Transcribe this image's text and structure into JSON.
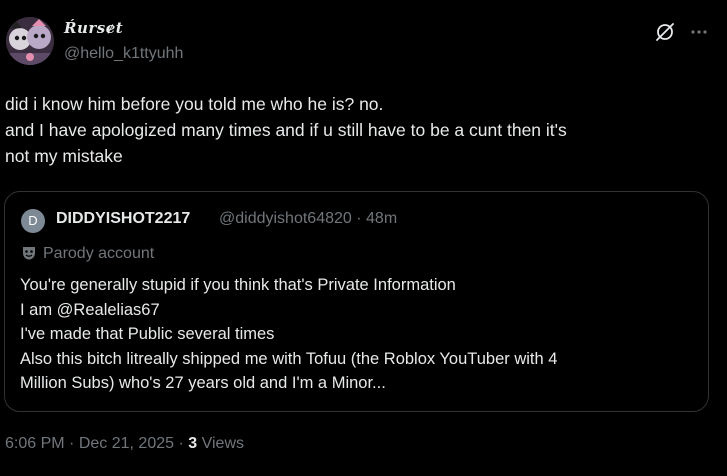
{
  "author": {
    "display_name": "Ŕursɇt",
    "handle": "@hello_k1ttyuhh"
  },
  "tweet": {
    "lines": [
      "did i know him before you told me who he is? no.",
      "and I have apologized many times and if u still have to be a cunt then it's",
      "not my mistake"
    ]
  },
  "quote": {
    "avatar_letter": "D",
    "display_name": "DIDDYISHOT2217",
    "handle": "@diddyishot64820",
    "separator": "·",
    "time": "48m",
    "badge_label": "Parody account",
    "lines": [
      "You're generally stupid if you think that's Private Information",
      "I am @Realelias67",
      "I've made that Public several times",
      "Also this bitch litreally shipped me with Tofuu (the Roblox YouTuber with 4",
      "Million Subs) who's 27 years old and I'm a Minor..."
    ]
  },
  "footer": {
    "time": "6:06 PM",
    "separator": "·",
    "date": "Dec 21, 2025",
    "views_count": "3",
    "views_label": "Views"
  },
  "icons": {
    "grok": "grok-icon",
    "more": "more-icon",
    "parody": "parody-mask-icon"
  },
  "colors": {
    "background": "#000000",
    "text": "#e7e9ea",
    "secondary": "#71767b",
    "border": "#2f3336"
  }
}
